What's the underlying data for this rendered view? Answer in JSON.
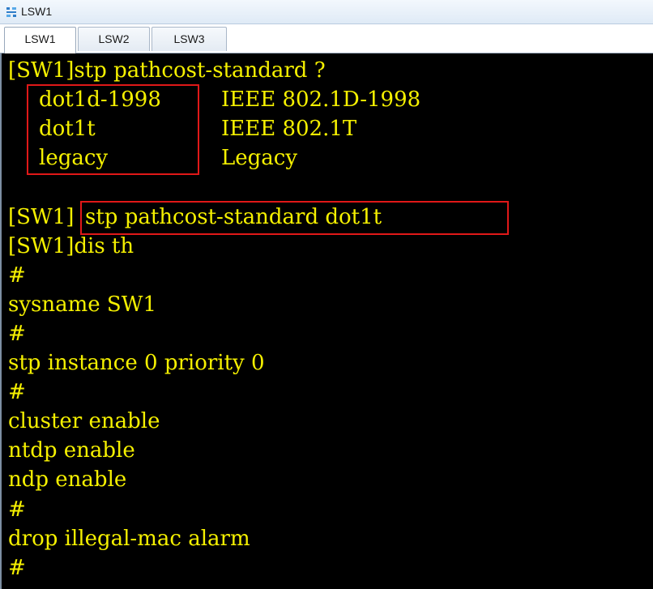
{
  "window": {
    "title": "LSW1",
    "icon": "network-switch-icon"
  },
  "tabs": [
    {
      "label": "LSW1",
      "active": true
    },
    {
      "label": "LSW2",
      "active": false
    },
    {
      "label": "LSW3",
      "active": false
    }
  ],
  "terminal": {
    "text_color": "#f5f000",
    "background_color": "#000000",
    "highlight_color": "#e01818",
    "prompt_help": "[SW1]stp pathcost-standard ?",
    "options": [
      {
        "keyword": "dot1d-1998",
        "description": "IEEE 802.1D-1998"
      },
      {
        "keyword": "dot1t",
        "description": "IEEE 802.1T"
      },
      {
        "keyword": "legacy",
        "description": "Legacy"
      }
    ],
    "prompt_prefix": "[SW1]",
    "command_entered": "stp pathcost-standard dot1t",
    "lines": [
      "[SW1]dis th",
      "#",
      "sysname SW1",
      "#",
      "stp instance 0 priority 0",
      "#",
      "cluster enable",
      "ntdp enable",
      "ndp enable",
      "#",
      "drop illegal-mac alarm",
      "#"
    ]
  }
}
